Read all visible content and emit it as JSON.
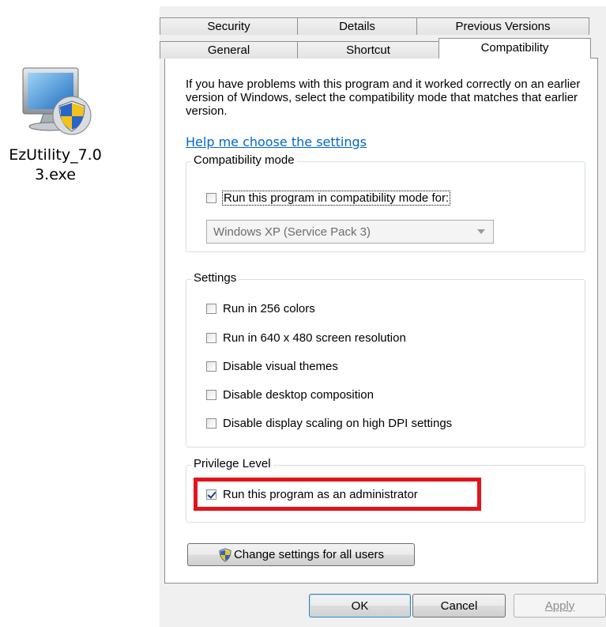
{
  "desktop_icon": {
    "label": "EzUtility_7.03.exe"
  },
  "dialog": {
    "tabs_back": [
      "Security",
      "Details",
      "Previous Versions"
    ],
    "tabs_front": [
      "General",
      "Shortcut",
      "Compatibility"
    ],
    "active_tab": "Compatibility",
    "intro_text": "If you have problems with this program and it worked correctly on an earlier version of Windows, select the compatibility mode that matches that earlier version.",
    "help_link": "Help me choose the settings",
    "compat_mode": {
      "title": "Compatibility mode",
      "checkbox_label": "Run this program in compatibility mode for:",
      "checked": false,
      "select_value": "Windows XP (Service Pack 3)"
    },
    "settings": {
      "title": "Settings",
      "items": [
        {
          "label": "Run in 256 colors",
          "checked": false
        },
        {
          "label": "Run in 640 x 480 screen resolution",
          "checked": false
        },
        {
          "label": "Disable visual themes",
          "checked": false
        },
        {
          "label": "Disable desktop composition",
          "checked": false
        },
        {
          "label": "Disable display scaling on high DPI settings",
          "checked": false
        }
      ]
    },
    "privilege": {
      "title": "Privilege Level",
      "checkbox_label": "Run this program as an administrator",
      "checked": true
    },
    "change_all_users_button": "Change settings for all users",
    "buttons": {
      "ok": "OK",
      "cancel": "Cancel",
      "apply": "Apply"
    }
  },
  "colors": {
    "highlight": "#e3141b",
    "link": "#0066cc",
    "dialog_bg": "#f0f0f0"
  }
}
